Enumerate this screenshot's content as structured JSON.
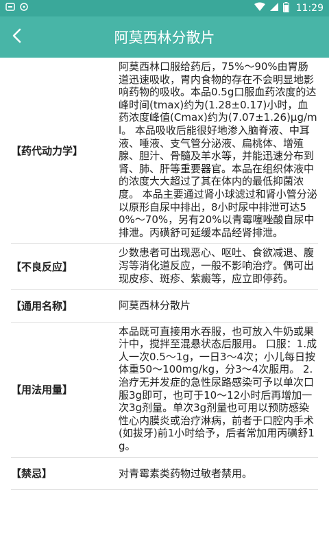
{
  "status_bar": {
    "time": "11:29",
    "icons": [
      "notification-icon",
      "sync-icon",
      "wifi-icon",
      "signal-icon",
      "battery-icon"
    ]
  },
  "app_bar": {
    "title": "阿莫西林分散片",
    "back_icon": "back-arrow-icon"
  },
  "colors": {
    "status_bar": "#3aa89a",
    "app_bar": "#48b5a7",
    "divider": "#e0e0e0"
  },
  "rows": [
    {
      "label": "【药代动力学】",
      "value": "阿莫西林口服给药后，75%～90%由胃肠道迅速吸收，胃内食物的存在不会明显地影响药物的吸收。本品0.5g口服血药浓度的达峰时间(tmax)约为(1.28±0.17)小时，血药浓度峰值(Cmax)约为(7.07±1.26)μg/ml。 本品吸收后能很好地渗入脑脊液、中耳液、唾液、支气管分泌液、扁桃体、增殖腺、胆汁、骨髓及羊水等，并能迅速分布到肾、肺、肝等重要器官。本品在组织体液中的浓度大大超过了其在体内的最低抑菌浓度。 本品主要通过肾小球滤过和肾小管分泌以原形自尿中排出，8小时尿中排泄可达50%～70%，另有20%以青霉噻唑酸自尿中排泄。丙磺舒可延缓本品经肾排泄。"
    },
    {
      "label": "【不良反应】",
      "value": "少数患者可出现恶心、呕吐、食欲减退、腹泻等消化道反应，一般不影响治疗。偶可出现皮疹、斑疹、紫癜等，应立即停药。"
    },
    {
      "label": "【通用名称】",
      "value": "阿莫西林分散片"
    },
    {
      "label": "【用法用量】",
      "value": "本品既可直接用水吞服，也可放入牛奶或果汁中，搅拌至混悬状态后服用。 口服：1.成人一次0.5～1g，一日3～4次；小儿每日按体重50～100mg/kg，分3～4次服用。 2.治疗无并发症的急性尿路感染可予以单次口服3g即可，也可于10～12小时后再增加一次3g剂量。单次3g剂量也可用以预防感染性心内膜炎或治疗淋病，前者于口腔内手术(如拔牙)前1小时给予，后者常加用丙磺舒1g。"
    },
    {
      "label": "【禁忌】",
      "value": "对青霉素类药物过敏者禁用。"
    }
  ]
}
